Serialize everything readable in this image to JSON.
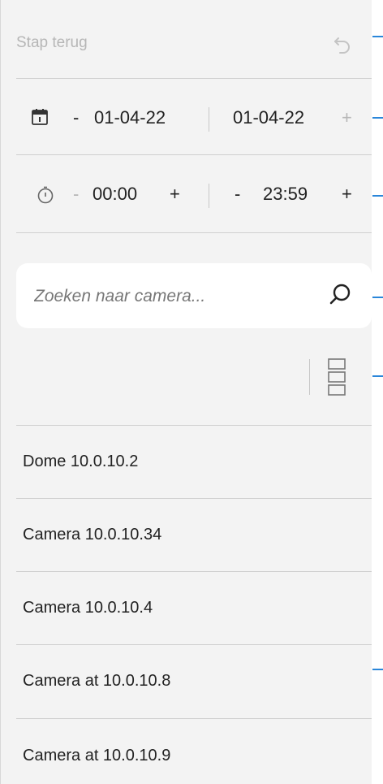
{
  "undo": {
    "label": "Stap terug",
    "icon": "undo-icon"
  },
  "date_range": {
    "icon": "calendar-icon",
    "start": {
      "minus": "-",
      "value": "01-04-22"
    },
    "end": {
      "value": "01-04-22",
      "plus": "+"
    }
  },
  "time_range": {
    "icon": "stopwatch-icon",
    "start": {
      "minus": "-",
      "value": "00:00",
      "plus": "+"
    },
    "end": {
      "minus": "-",
      "value": "23:59",
      "plus": "+"
    }
  },
  "search": {
    "placeholder": "Zoeken naar camera...",
    "value": "",
    "icon": "search-icon"
  },
  "view_toggle": {
    "icon": "list-view-icon"
  },
  "cameras": [
    {
      "label": "Dome 10.0.10.2"
    },
    {
      "label": "Camera 10.0.10.34"
    },
    {
      "label": "Camera 10.0.10.4"
    },
    {
      "label": "Camera at 10.0.10.8"
    },
    {
      "label": "Camera at 10.0.10.9"
    }
  ],
  "colors": {
    "panel_bg": "#f3f3f3",
    "accent": "#2a86d9",
    "text": "#222222",
    "muted": "#b6b6b6"
  }
}
